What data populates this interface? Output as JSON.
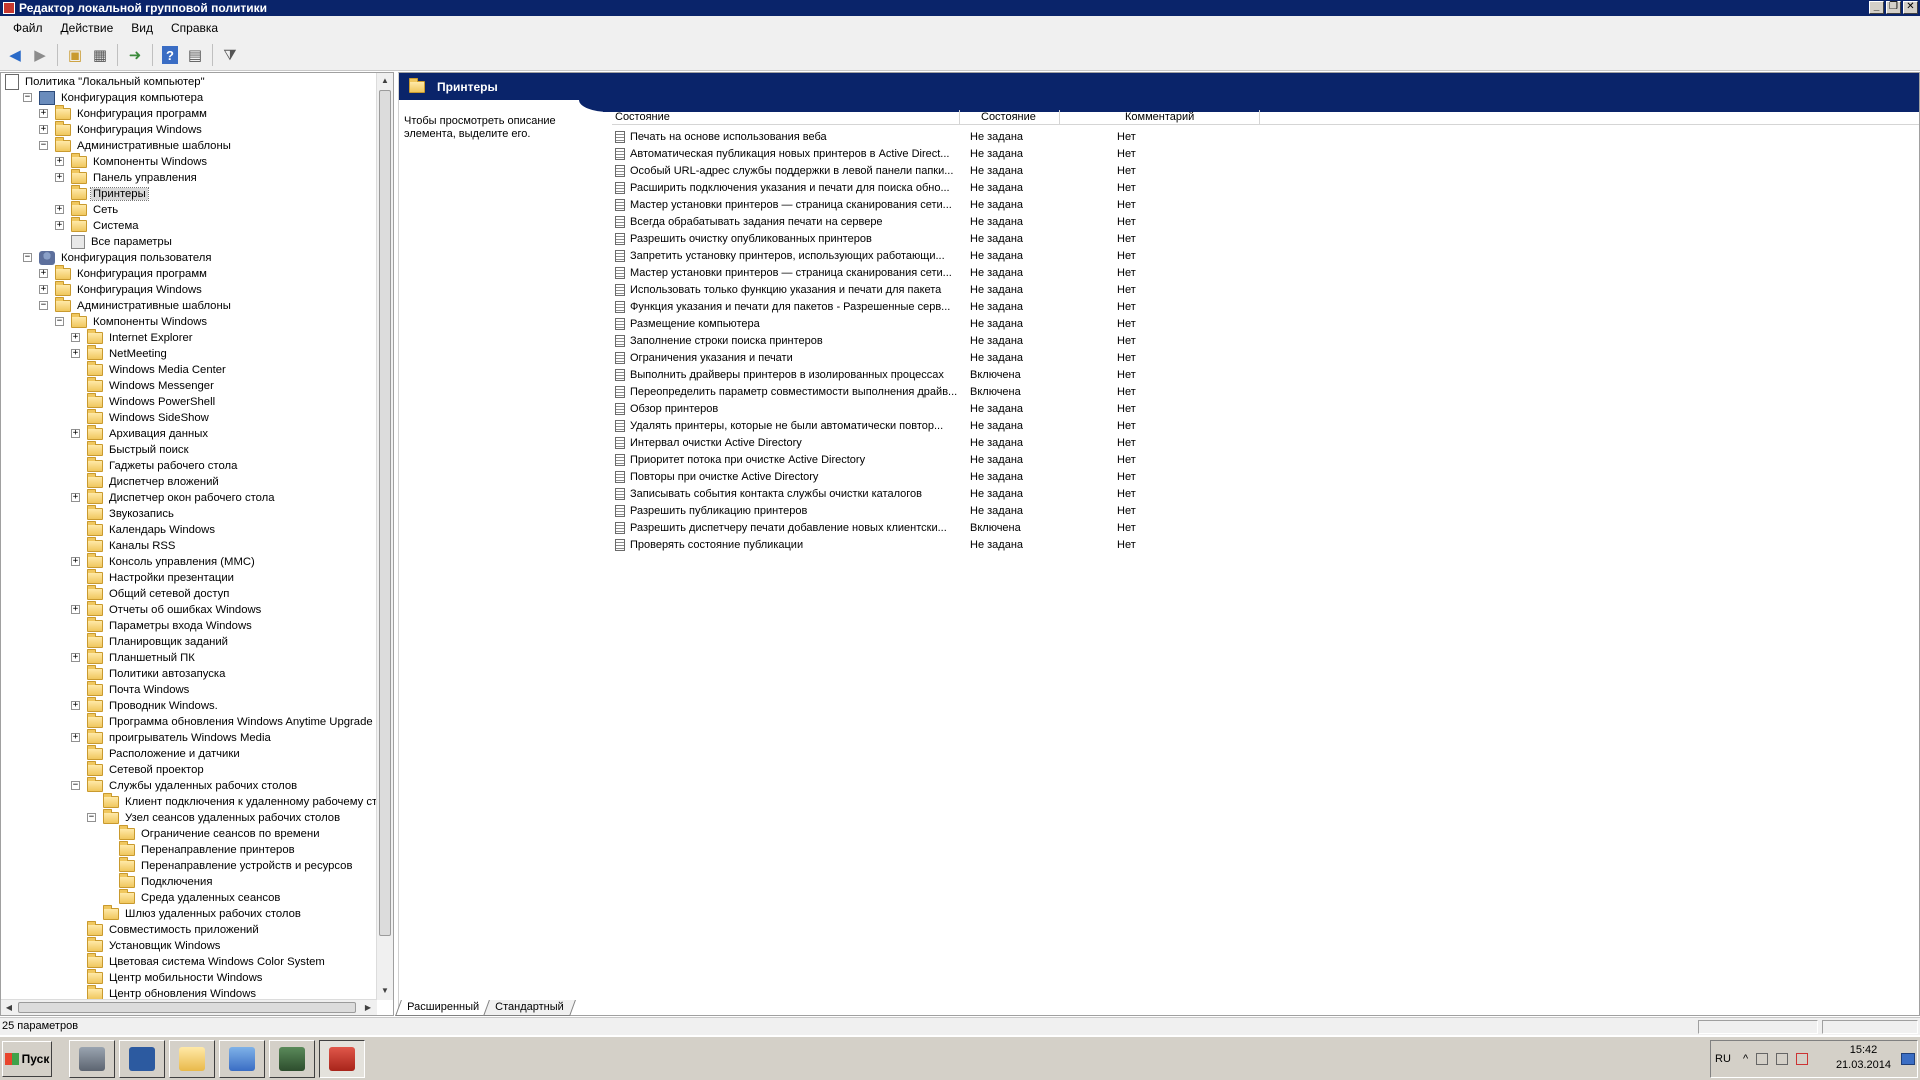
{
  "window": {
    "title": "Редактор локальной групповой политики"
  },
  "menu": [
    "Файл",
    "Действие",
    "Вид",
    "Справка"
  ],
  "toolbar": {
    "help_label": "?"
  },
  "tree": [
    {
      "label": "Политика \"Локальный компьютер\"",
      "level": 0,
      "icon": "policy-icon",
      "exp": ""
    },
    {
      "label": "Конфигурация компьютера",
      "level": 1,
      "icon": "computer-icon",
      "exp": "-"
    },
    {
      "label": "Конфигурация программ",
      "level": 2,
      "icon": "folder-icon",
      "exp": "+"
    },
    {
      "label": "Конфигурация Windows",
      "level": 2,
      "icon": "folder-icon",
      "exp": "+"
    },
    {
      "label": "Административные шаблоны",
      "level": 2,
      "icon": "folder-icon",
      "exp": "-"
    },
    {
      "label": "Компоненты Windows",
      "level": 3,
      "icon": "folder-icon",
      "exp": "+"
    },
    {
      "label": "Панель управления",
      "level": 3,
      "icon": "folder-icon",
      "exp": "+"
    },
    {
      "label": "Принтеры",
      "level": 3,
      "icon": "folder-icon",
      "exp": "",
      "selected": true
    },
    {
      "label": "Сеть",
      "level": 3,
      "icon": "folder-icon",
      "exp": "+"
    },
    {
      "label": "Система",
      "level": 3,
      "icon": "folder-icon",
      "exp": "+"
    },
    {
      "label": "Все параметры",
      "level": 3,
      "icon": "settings-icon",
      "exp": ""
    },
    {
      "label": "Конфигурация пользователя",
      "level": 1,
      "icon": "user-icon",
      "exp": "-"
    },
    {
      "label": "Конфигурация программ",
      "level": 2,
      "icon": "folder-icon",
      "exp": "+"
    },
    {
      "label": "Конфигурация Windows",
      "level": 2,
      "icon": "folder-icon",
      "exp": "+"
    },
    {
      "label": "Административные шаблоны",
      "level": 2,
      "icon": "folder-icon",
      "exp": "-"
    },
    {
      "label": "Компоненты Windows",
      "level": 3,
      "icon": "folder-icon",
      "exp": "-"
    },
    {
      "label": "Internet Explorer",
      "level": 4,
      "icon": "folder-icon",
      "exp": "+"
    },
    {
      "label": "NetMeeting",
      "level": 4,
      "icon": "folder-icon",
      "exp": "+"
    },
    {
      "label": "Windows Media Center",
      "level": 4,
      "icon": "folder-icon",
      "exp": ""
    },
    {
      "label": "Windows Messenger",
      "level": 4,
      "icon": "folder-icon",
      "exp": ""
    },
    {
      "label": "Windows PowerShell",
      "level": 4,
      "icon": "folder-icon",
      "exp": ""
    },
    {
      "label": "Windows SideShow",
      "level": 4,
      "icon": "folder-icon",
      "exp": ""
    },
    {
      "label": "Архивация данных",
      "level": 4,
      "icon": "folder-icon",
      "exp": "+"
    },
    {
      "label": "Быстрый поиск",
      "level": 4,
      "icon": "folder-icon",
      "exp": ""
    },
    {
      "label": "Гаджеты рабочего стола",
      "level": 4,
      "icon": "folder-icon",
      "exp": ""
    },
    {
      "label": "Диспетчер вложений",
      "level": 4,
      "icon": "folder-icon",
      "exp": ""
    },
    {
      "label": "Диспетчер окон рабочего стола",
      "level": 4,
      "icon": "folder-icon",
      "exp": "+"
    },
    {
      "label": "Звукозапись",
      "level": 4,
      "icon": "folder-icon",
      "exp": ""
    },
    {
      "label": "Календарь Windows",
      "level": 4,
      "icon": "folder-icon",
      "exp": ""
    },
    {
      "label": "Каналы RSS",
      "level": 4,
      "icon": "folder-icon",
      "exp": ""
    },
    {
      "label": "Консоль управления (MMC)",
      "level": 4,
      "icon": "folder-icon",
      "exp": "+"
    },
    {
      "label": "Настройки презентации",
      "level": 4,
      "icon": "folder-icon",
      "exp": ""
    },
    {
      "label": "Общий сетевой доступ",
      "level": 4,
      "icon": "folder-icon",
      "exp": ""
    },
    {
      "label": "Отчеты об ошибках Windows",
      "level": 4,
      "icon": "folder-icon",
      "exp": "+"
    },
    {
      "label": "Параметры входа Windows",
      "level": 4,
      "icon": "folder-icon",
      "exp": ""
    },
    {
      "label": "Планировщик заданий",
      "level": 4,
      "icon": "folder-icon",
      "exp": ""
    },
    {
      "label": "Планшетный ПК",
      "level": 4,
      "icon": "folder-icon",
      "exp": "+"
    },
    {
      "label": "Политики автозапуска",
      "level": 4,
      "icon": "folder-icon",
      "exp": ""
    },
    {
      "label": "Почта Windows",
      "level": 4,
      "icon": "folder-icon",
      "exp": ""
    },
    {
      "label": "Проводник Windows.",
      "level": 4,
      "icon": "folder-icon",
      "exp": "+"
    },
    {
      "label": "Программа обновления Windows Anytime Upgrade",
      "level": 4,
      "icon": "folder-icon",
      "exp": ""
    },
    {
      "label": "проигрыватель Windows Media",
      "level": 4,
      "icon": "folder-icon",
      "exp": "+"
    },
    {
      "label": "Расположение и датчики",
      "level": 4,
      "icon": "folder-icon",
      "exp": ""
    },
    {
      "label": "Сетевой проектор",
      "level": 4,
      "icon": "folder-icon",
      "exp": ""
    },
    {
      "label": "Службы удаленных рабочих столов",
      "level": 4,
      "icon": "folder-icon",
      "exp": "-"
    },
    {
      "label": "Клиент подключения к удаленному рабочему сто...",
      "level": 5,
      "icon": "folder-icon",
      "exp": ""
    },
    {
      "label": "Узел сеансов удаленных рабочих столов",
      "level": 5,
      "icon": "folder-icon",
      "exp": "-"
    },
    {
      "label": "Ограничение сеансов по времени",
      "level": 6,
      "icon": "folder-icon",
      "exp": ""
    },
    {
      "label": "Перенаправление принтеров",
      "level": 6,
      "icon": "folder-icon",
      "exp": ""
    },
    {
      "label": "Перенаправление устройств и ресурсов",
      "level": 6,
      "icon": "folder-icon",
      "exp": ""
    },
    {
      "label": "Подключения",
      "level": 6,
      "icon": "folder-icon",
      "exp": ""
    },
    {
      "label": "Среда удаленных сеансов",
      "level": 6,
      "icon": "folder-icon",
      "exp": ""
    },
    {
      "label": "Шлюз удаленных рабочих столов",
      "level": 5,
      "icon": "folder-icon",
      "exp": ""
    },
    {
      "label": "Совместимость приложений",
      "level": 4,
      "icon": "folder-icon",
      "exp": ""
    },
    {
      "label": "Установщик Windows",
      "level": 4,
      "icon": "folder-icon",
      "exp": ""
    },
    {
      "label": "Цветовая система Windows Color System",
      "level": 4,
      "icon": "folder-icon",
      "exp": ""
    },
    {
      "label": "Центр мобильности Windows",
      "level": 4,
      "icon": "folder-icon",
      "exp": ""
    },
    {
      "label": "Центр обновления Windows",
      "level": 4,
      "icon": "folder-icon",
      "exp": ""
    }
  ],
  "content": {
    "title": "Принтеры",
    "description": "Чтобы просмотреть описание элемента, выделите его.",
    "columns": [
      "Состояние",
      "Состояние",
      "Комментарий"
    ],
    "rows": [
      {
        "name": "Печать на основе использования веба",
        "state": "Не задана",
        "comment": "Нет"
      },
      {
        "name": "Автоматическая публикация новых принтеров в Active Direct...",
        "state": "Не задана",
        "comment": "Нет"
      },
      {
        "name": "Особый URL-адрес службы поддержки в левой панели папки...",
        "state": "Не задана",
        "comment": "Нет"
      },
      {
        "name": "Расширить подключения указания и печати для поиска обно...",
        "state": "Не задана",
        "comment": "Нет"
      },
      {
        "name": "Мастер установки принтеров — страница сканирования сети...",
        "state": "Не задана",
        "comment": "Нет"
      },
      {
        "name": "Всегда обрабатывать задания печати на сервере",
        "state": "Не задана",
        "comment": "Нет"
      },
      {
        "name": "Разрешить очистку опубликованных принтеров",
        "state": "Не задана",
        "comment": "Нет"
      },
      {
        "name": "Запретить установку принтеров, использующих работающи...",
        "state": "Не задана",
        "comment": "Нет"
      },
      {
        "name": "Мастер установки принтеров — страница сканирования сети...",
        "state": "Не задана",
        "comment": "Нет"
      },
      {
        "name": "Использовать только функцию указания и печати для пакета",
        "state": "Не задана",
        "comment": "Нет"
      },
      {
        "name": "Функция указания и печати для пакетов - Разрешенные серв...",
        "state": "Не задана",
        "comment": "Нет"
      },
      {
        "name": "Размещение компьютера",
        "state": "Не задана",
        "comment": "Нет"
      },
      {
        "name": "Заполнение строки поиска принтеров",
        "state": "Не задана",
        "comment": "Нет"
      },
      {
        "name": "Ограничения указания и печати",
        "state": "Не задана",
        "comment": "Нет"
      },
      {
        "name": "Выполнить драйверы принтеров в изолированных процессах",
        "state": "Включена",
        "comment": "Нет"
      },
      {
        "name": "Переопределить параметр совместимости выполнения драйв...",
        "state": "Включена",
        "comment": "Нет"
      },
      {
        "name": "Обзор принтеров",
        "state": "Не задана",
        "comment": "Нет"
      },
      {
        "name": "Удалять принтеры, которые не были автоматически повтор...",
        "state": "Не задана",
        "comment": "Нет"
      },
      {
        "name": "Интервал очистки Active Directory",
        "state": "Не задана",
        "comment": "Нет"
      },
      {
        "name": "Приоритет потока при очистке Active Directory",
        "state": "Не задана",
        "comment": "Нет"
      },
      {
        "name": "Повторы при очистке Active Directory",
        "state": "Не задана",
        "comment": "Нет"
      },
      {
        "name": "Записывать события контакта службы очистки каталогов",
        "state": "Не задана",
        "comment": "Нет"
      },
      {
        "name": "Разрешить публикацию принтеров",
        "state": "Не задана",
        "comment": "Нет"
      },
      {
        "name": "Разрешить диспетчеру печати добавление новых клиентски...",
        "state": "Включена",
        "comment": "Нет"
      },
      {
        "name": "Проверять состояние публикации",
        "state": "Не задана",
        "comment": "Нет"
      }
    ],
    "tabs": [
      "Расширенный",
      "Стандартный"
    ]
  },
  "status": {
    "text": "25 параметров"
  },
  "taskbar": {
    "start_label": "Пуск",
    "buttons": [
      "server-manager-icon",
      "powershell-icon",
      "explorer-icon",
      "control-panel-icon",
      "task-manager-icon",
      "gpedit-icon"
    ],
    "lang": "RU",
    "time": "15:42",
    "date": "21.03.2014"
  }
}
